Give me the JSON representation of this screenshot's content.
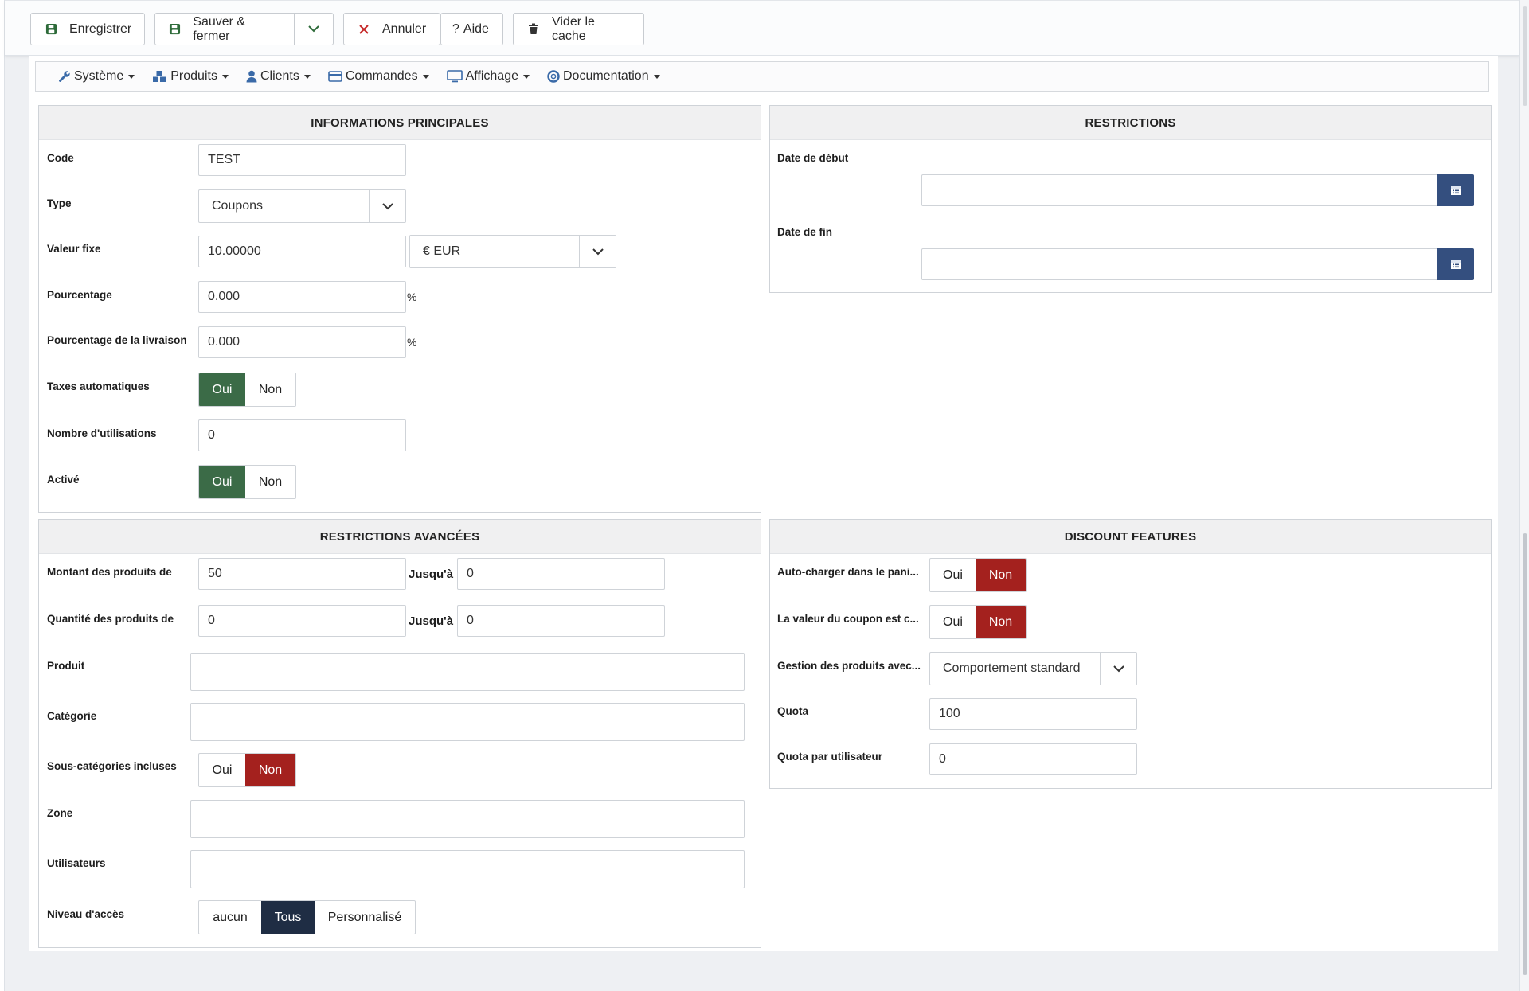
{
  "toolbar": {
    "save": "Enregistrer",
    "save_close": "Sauver & fermer",
    "cancel": "Annuler",
    "help": "Aide",
    "clear_cache": "Vider le cache"
  },
  "menu": {
    "systeme": "Système",
    "produits": "Produits",
    "clients": "Clients",
    "commandes": "Commandes",
    "affichage": "Affichage",
    "documentation": "Documentation"
  },
  "main_info": {
    "title": "INFORMATIONS PRINCIPALES",
    "code_label": "Code",
    "code_value": "TEST",
    "type_label": "Type",
    "type_value": "Coupons",
    "fixed_label": "Valeur fixe",
    "fixed_value": "10.00000",
    "currency_value": "€ EUR",
    "percent_label": "Pourcentage",
    "percent_value": "0.000",
    "percent_unit": "%",
    "ship_percent_label": "Pourcentage de la livraison",
    "ship_percent_value": "0.000",
    "ship_percent_unit": "%",
    "auto_tax_label": "Taxes automatiques",
    "uses_label": "Nombre d'utilisations",
    "uses_value": "0",
    "active_label": "Activé"
  },
  "toggle": {
    "yes": "Oui",
    "no": "Non"
  },
  "restrictions": {
    "title": "RESTRICTIONS",
    "start_label": "Date de début",
    "start_value": "",
    "end_label": "Date de fin",
    "end_value": ""
  },
  "advanced": {
    "title": "RESTRICTIONS AVANCÉES",
    "amount_label": "Montant des produits de",
    "amount_from": "50",
    "until_label": "Jusqu'à",
    "amount_to": "0",
    "qty_label": "Quantité des produits de",
    "qty_from": "0",
    "qty_to": "0",
    "product_label": "Produit",
    "category_label": "Catégorie",
    "subcat_label": "Sous-catégories incluses",
    "zone_label": "Zone",
    "users_label": "Utilisateurs",
    "access_label": "Niveau d'accès",
    "access_none": "aucun",
    "access_all": "Tous",
    "access_custom": "Personnalisé"
  },
  "discount": {
    "title": "DISCOUNT FEATURES",
    "autoload_label": "Auto-charger dans le pani...",
    "coupon_value_label": "La valeur du coupon est c...",
    "product_mgmt_label": "Gestion des produits avec...",
    "product_mgmt_value": "Comportement standard",
    "quota_label": "Quota",
    "quota_value": "100",
    "quota_user_label": "Quota par utilisateur",
    "quota_user_value": "0"
  },
  "colors": {
    "green": "#3b6b47",
    "red": "#a4211e",
    "dark": "#1f2d44",
    "calendar": "#344f7f"
  }
}
